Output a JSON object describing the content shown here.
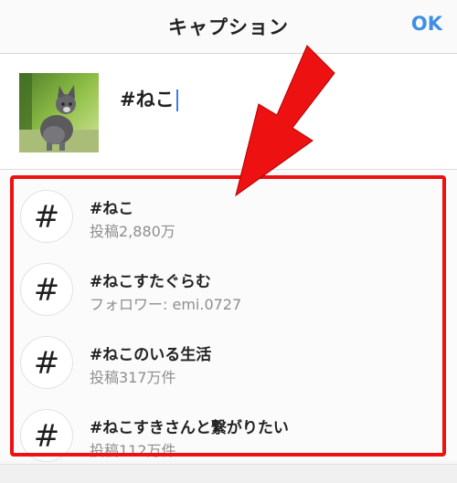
{
  "header": {
    "title": "キャプション",
    "ok_label": "OK"
  },
  "composer": {
    "caption": "#ねこ",
    "thumbnail_icon": "cat-photo"
  },
  "suggestions": [
    {
      "tag": "#ねこ",
      "sub": "投稿2,880万"
    },
    {
      "tag": "#ねこすたぐらむ",
      "sub": "フォロワー: emi.0727"
    },
    {
      "tag": "#ねこのいる生活",
      "sub": "投稿317万件"
    },
    {
      "tag": "#ねこすきさんと繋がりたい",
      "sub": "投稿112万件"
    }
  ],
  "hash_symbol": "#",
  "colors": {
    "accent": "#3f8fe3",
    "highlight": "#ee1111"
  }
}
